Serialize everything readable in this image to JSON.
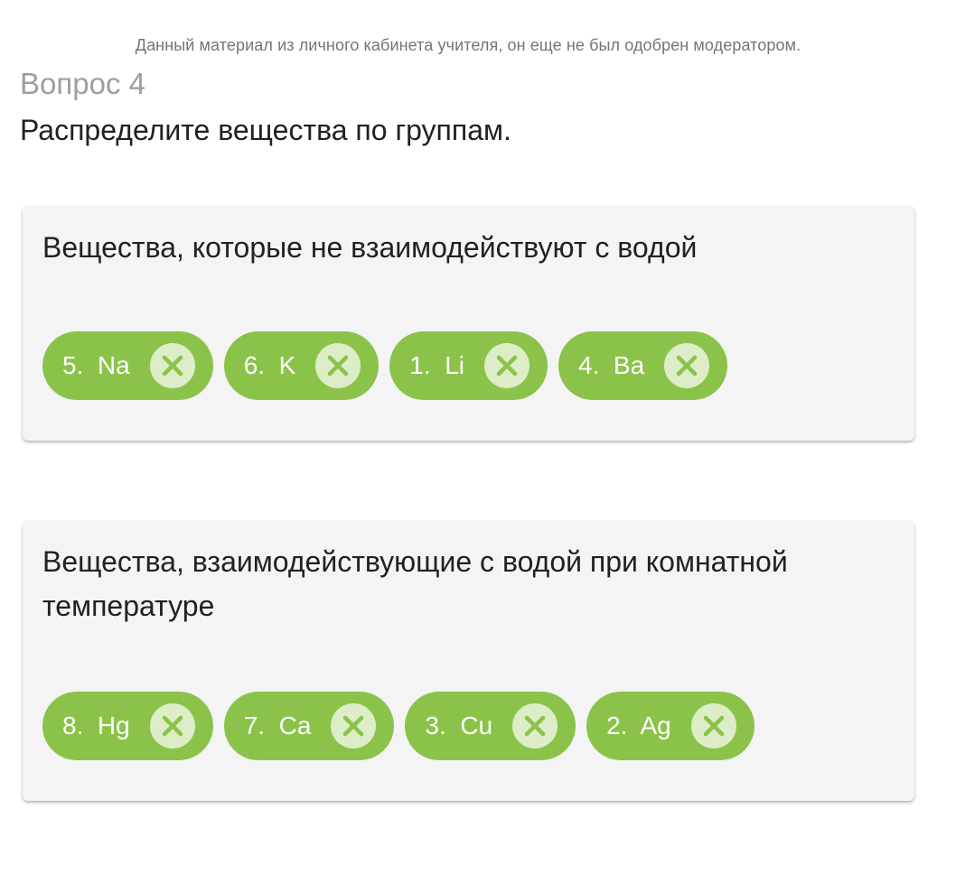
{
  "notice": "Данный материал из личного кабинета учителя, он еще не был одобрен модератором.",
  "question": {
    "number": "Вопрос 4",
    "text": "Распределите вещества по группам."
  },
  "groups": [
    {
      "title": "Вещества, которые не взаимодействуют с водой",
      "items": [
        {
          "label": "5.  Na"
        },
        {
          "label": "6.  K"
        },
        {
          "label": "1.  Li"
        },
        {
          "label": "4.  Ba"
        }
      ]
    },
    {
      "title": "Вещества, взаимодействующие с водой при комнатной температуре",
      "items": [
        {
          "label": "8.  Hg"
        },
        {
          "label": "7.  Ca"
        },
        {
          "label": "3.  Cu"
        },
        {
          "label": "2.  Ag"
        }
      ]
    }
  ],
  "icons": {
    "remove": "close-icon"
  },
  "colors": {
    "chip": "#8bc34a",
    "chip_remove_bg": "#dcedc8",
    "chip_remove_icon": "#8bc34a",
    "card": "#f4f4f4"
  }
}
